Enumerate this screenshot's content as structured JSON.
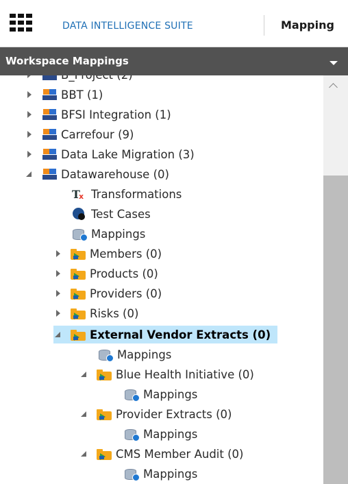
{
  "header": {
    "suite_name": "DATA INTELLIGENCE SUITE",
    "tab_title": "Mapping"
  },
  "workspace": {
    "title": "Workspace Mappings"
  },
  "tree": {
    "partial_top": "B_Project (2)",
    "projects": [
      {
        "label": "BBT (1)"
      },
      {
        "label": "BFSI Integration (1)"
      },
      {
        "label": "Carrefour (9)"
      },
      {
        "label": "Data Lake Migration (3)"
      },
      {
        "label": "Datawarehouse (0)"
      }
    ],
    "children": {
      "transformations": "Transformations",
      "test_cases": "Test Cases",
      "mappings": "Mappings",
      "members": "Members (0)",
      "products": "Products (0)",
      "providers": "Providers (0)",
      "risks": "Risks (0)",
      "external_vendor_extracts": "External Vendor Extracts (0)",
      "evx_mappings": "Mappings",
      "blue_health": "Blue Health Initiative (0)",
      "blue_health_mappings": "Mappings",
      "provider_extracts": "Provider Extracts (0)",
      "provider_extracts_mappings": "Mappings",
      "cms_member_audit": "CMS Member Audit (0)",
      "cms_member_audit_mappings": "Mappings"
    }
  },
  "colors": {
    "accent": "#1e6fb5",
    "workspace_bar": "#525252",
    "selection": "#bfe6fb"
  },
  "icons": [
    "apps-grid-icon",
    "project-icon",
    "subject-folder-icon",
    "mappings-db-icon",
    "transformations-icon",
    "test-cases-icon",
    "expand-arrow-icon",
    "collapse-arrow-icon",
    "dropdown-caret-icon",
    "scroll-up-icon"
  ]
}
